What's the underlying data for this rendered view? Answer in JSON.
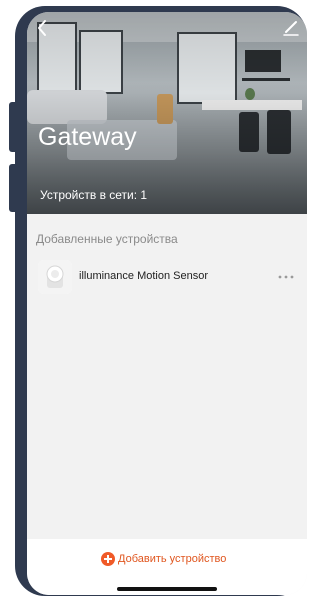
{
  "header": {
    "title": "Gateway",
    "devices_online": "Устройств в сети: 1"
  },
  "icons": {
    "back": "chevron-left-icon",
    "edit": "pencil-icon",
    "more": "ellipsis-icon",
    "add": "plus-circle-icon"
  },
  "devices_section": {
    "label": "Добавленные устройства",
    "items": [
      {
        "name": "illuminance Motion Sensor"
      }
    ]
  },
  "footer": {
    "add_label": "Добавить устройство"
  },
  "colors": {
    "accent": "#f05a28",
    "frame": "#2f3a4f",
    "background": "#f2f2f2"
  }
}
